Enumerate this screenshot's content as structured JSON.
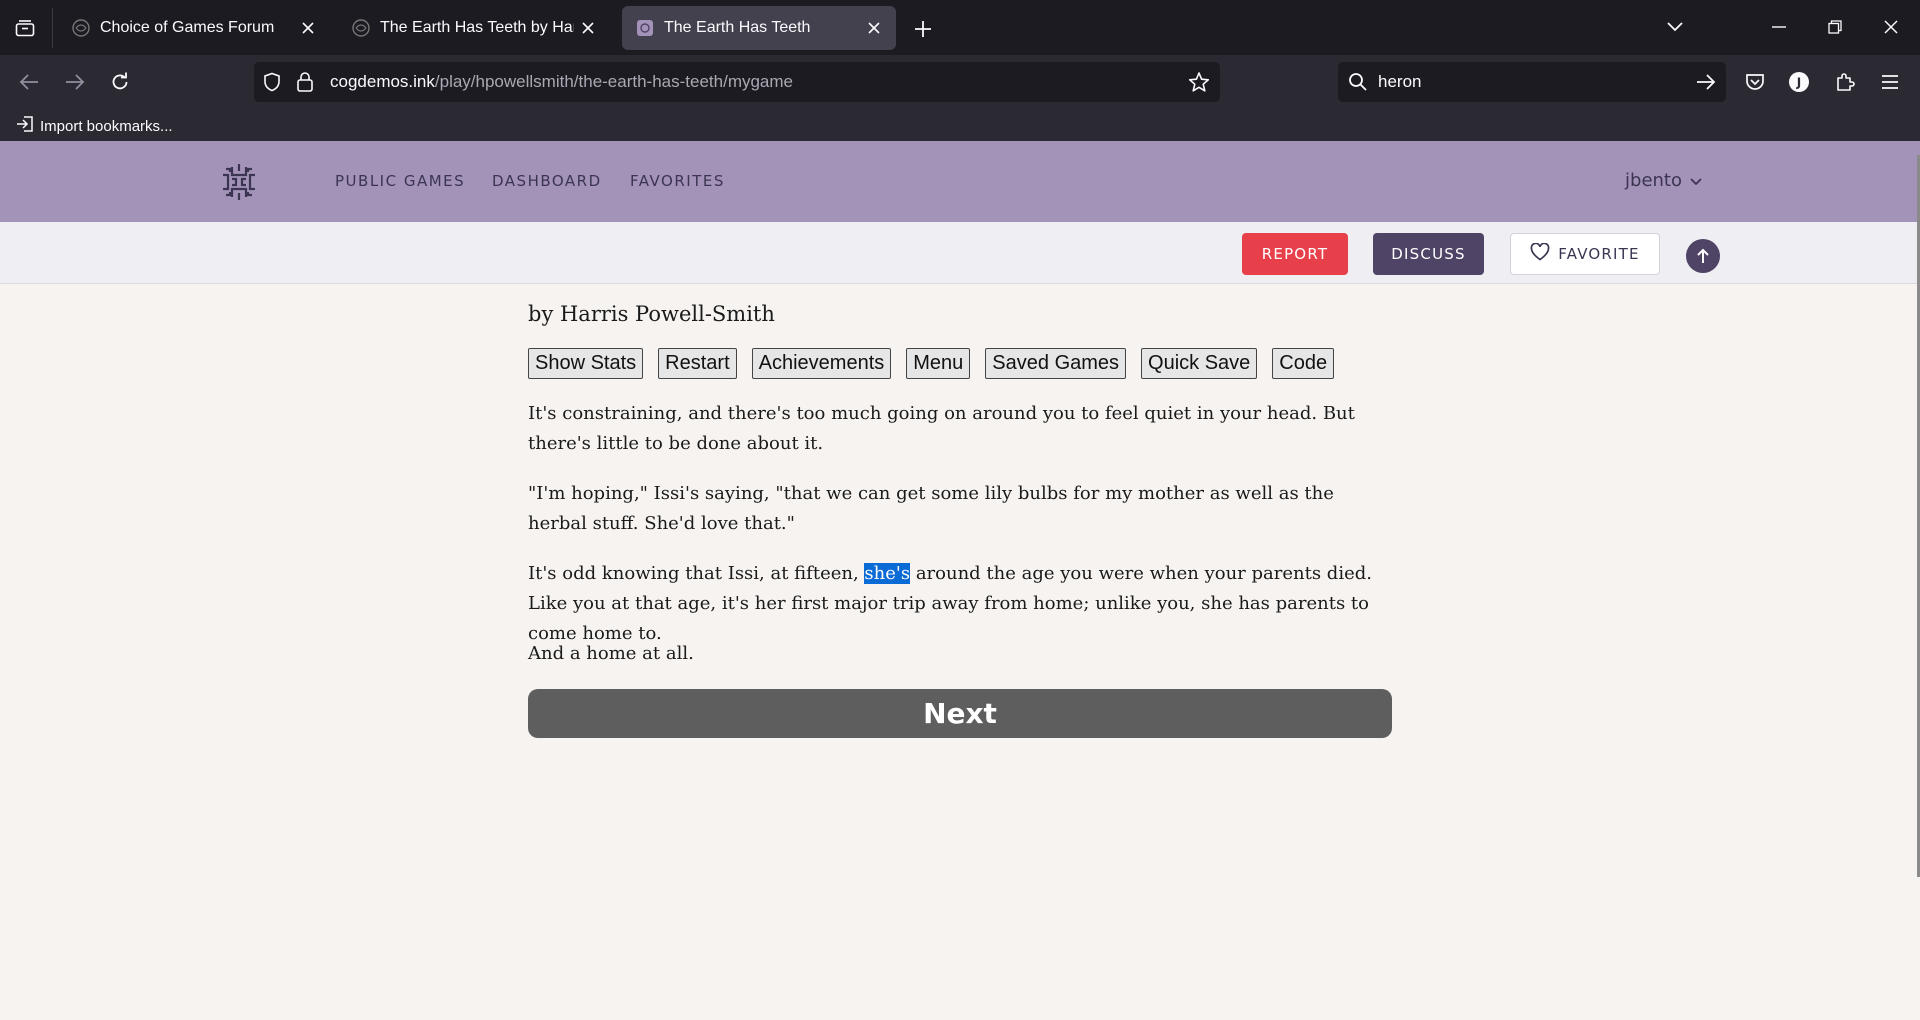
{
  "browser": {
    "tabs": [
      {
        "title": "Choice of Games Forum",
        "active": false
      },
      {
        "title": "The Earth Has Teeth by Harris Powell-Smith",
        "active": false
      },
      {
        "title": "The Earth Has Teeth",
        "active": true
      }
    ],
    "url_host": "cogdemos.ink",
    "url_path": "/play/hpowellsmith/the-earth-has-teeth/mygame",
    "search_value": "heron",
    "bookmark_label": "Import bookmarks..."
  },
  "site": {
    "nav": [
      "PUBLIC GAMES",
      "DASHBOARD",
      "FAVORITES"
    ],
    "user": "jbento",
    "actions": {
      "report": "REPORT",
      "discuss": "DISCUSS",
      "favorite": "FAVORITE"
    }
  },
  "game": {
    "author": "by Harris Powell-Smith",
    "buttons": [
      "Show Stats",
      "Restart",
      "Achievements",
      "Menu",
      "Saved Games",
      "Quick Save",
      "Code"
    ],
    "p1": "It's constraining, and there's too much going on around you to feel quiet in your head. But there's little to be done about it.",
    "p2": "\"I'm hoping,\" Issi's saying, \"that we can get some lily bulbs for my mother as well as the herbal stuff. She'd love that.\"",
    "p3_before": "It's odd knowing that Issi, at fifteen, ",
    "p3_highlight": "she's",
    "p3_after": " around the age you were when your parents died. Like you at that age, it's her first major trip away from home; unlike you, she has parents to come home to.",
    "p4": "And a home at all.",
    "next_label": "Next"
  },
  "colors": {
    "header_bg": "#a393b8",
    "report": "#e8404a",
    "discuss": "#4f4366",
    "selection": "#0a6ad6",
    "next_bg": "#5e5e5e"
  }
}
